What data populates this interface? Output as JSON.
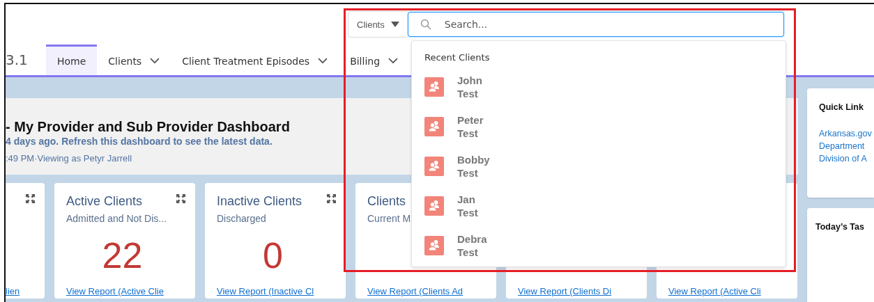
{
  "header": {
    "scope_selector": {
      "label": "Clients"
    },
    "search": {
      "placeholder": "Search..."
    }
  },
  "nav": {
    "app_name": "3.1",
    "tabs": [
      {
        "label": "Home",
        "selected": true,
        "has_menu": false
      },
      {
        "label": "Clients",
        "selected": false,
        "has_menu": true
      },
      {
        "label": "Client Treatment Episodes",
        "selected": false,
        "has_menu": true
      },
      {
        "label": "Billing",
        "selected": false,
        "has_menu": true
      }
    ]
  },
  "dashboard": {
    "title": "- My Provider and Sub Provider Dashboard",
    "refresh_note": "4 days ago. Refresh this dashboard to see the latest data.",
    "viewing_as": ":49 PM·Viewing as Petyr Jarrell"
  },
  "cards": [
    {
      "expandable": true,
      "link": "lien"
    },
    {
      "title": "Active Clients",
      "subtitle": "Admitted and Not Dis...",
      "value": "22",
      "expandable": true,
      "link": "View Report (Active Clie"
    },
    {
      "title": "Inactive Clients",
      "subtitle": "Discharged",
      "value": "0",
      "expandable": true,
      "link": "View Report (Inactive Cl"
    },
    {
      "title": "Clients",
      "subtitle": "Current M",
      "expandable": false,
      "link": "View Report (Clients Ad"
    },
    {
      "expandable": false,
      "link": "View Report (Clients Di"
    },
    {
      "expandable": false,
      "link": "View Report (Active Cli"
    }
  ],
  "quick_links": {
    "title": "Quick Link",
    "links": [
      "Arkansas.gov",
      "Department",
      "Division of A"
    ]
  },
  "tasks": {
    "title": "Today’s Tas"
  },
  "search_dropdown": {
    "heading": "Recent Clients",
    "items": [
      {
        "name": "John Test"
      },
      {
        "name": "Peter Test"
      },
      {
        "name": "Bobby Test"
      },
      {
        "name": "Jan Test"
      },
      {
        "name": "Debra Test"
      }
    ]
  }
}
